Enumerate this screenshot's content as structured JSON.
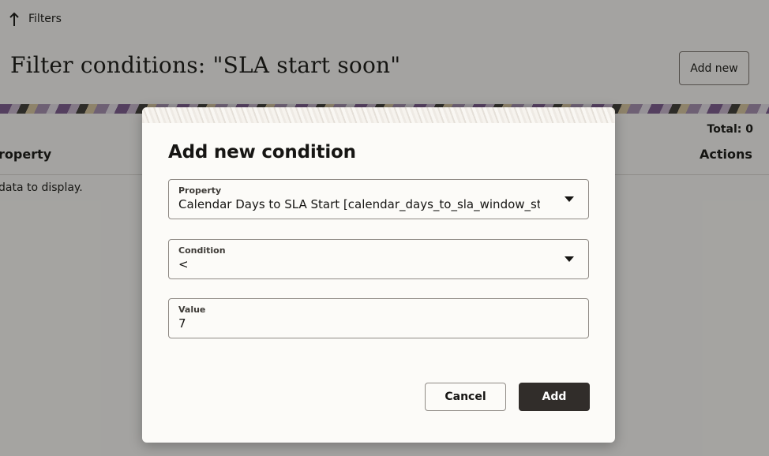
{
  "nav": {
    "back_label": "Filters"
  },
  "page": {
    "title": "Filter conditions: \"SLA start soon\"",
    "add_new_label": "Add new"
  },
  "table": {
    "total_label": "Total: 0",
    "columns": [
      "roperty",
      "Actions"
    ],
    "empty_text": "data to display."
  },
  "dialog": {
    "title": "Add new condition",
    "fields": [
      {
        "label": "Property",
        "value": "Calendar Days to SLA Start [calendar_days_to_sla_window_start]"
      },
      {
        "label": "Condition",
        "value": "<"
      },
      {
        "label": "Value",
        "value": "7"
      }
    ],
    "cancel_label": "Cancel",
    "add_label": "Add"
  },
  "colors": {
    "primary_button": "#312d2a",
    "scrim": "rgba(22,21,19,0.38)"
  },
  "icons": {
    "back": "arrow-up-icon",
    "dropdown": "chevron-down-icon"
  }
}
